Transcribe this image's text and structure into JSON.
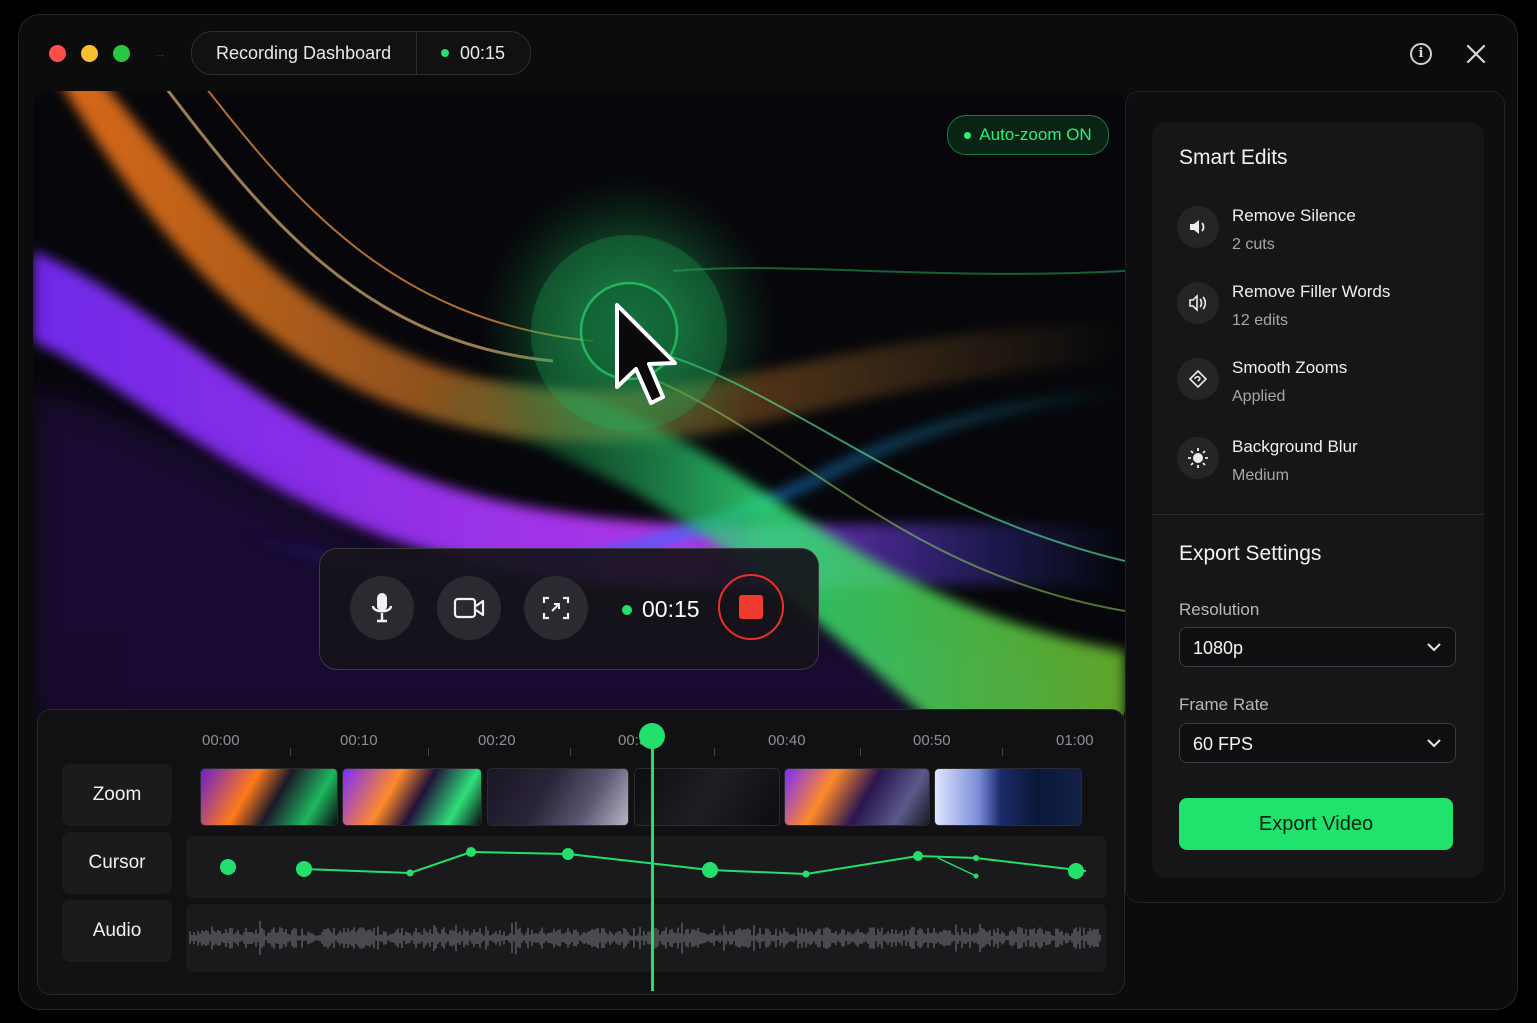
{
  "titlebar": {
    "title": "Recording Dashboard",
    "elapsed": "00:15"
  },
  "preview": {
    "autozoom_label": "Auto-zoom ON"
  },
  "controls": {
    "timer": "00:15",
    "icons": [
      "microphone-icon",
      "camera-icon",
      "screen-capture-icon",
      "stop-icon"
    ]
  },
  "smart_edits": {
    "title": "Smart Edits",
    "items": [
      {
        "label": "Remove Silence",
        "sub": "2 cuts",
        "icon": "speaker-icon"
      },
      {
        "label": "Remove Filler Words",
        "sub": "12 edits",
        "icon": "voice-wave-icon"
      },
      {
        "label": "Smooth Zooms",
        "sub": "Applied",
        "icon": "zoom-rotate-icon"
      },
      {
        "label": "Background Blur",
        "sub": "Medium",
        "icon": "sun-icon"
      }
    ]
  },
  "export": {
    "title": "Export Settings",
    "resolution_label": "Resolution",
    "resolution_value": "1080p",
    "framerate_label": "Frame Rate",
    "framerate_value": "60 FPS",
    "button": "Export Video"
  },
  "timeline": {
    "ruler": [
      "00:00",
      "00:10",
      "00:20",
      "00:30",
      "00:40",
      "00:50",
      "01:00"
    ],
    "tracks": [
      "Zoom",
      "Cursor",
      "Audio"
    ],
    "accent": "#22e06b"
  }
}
